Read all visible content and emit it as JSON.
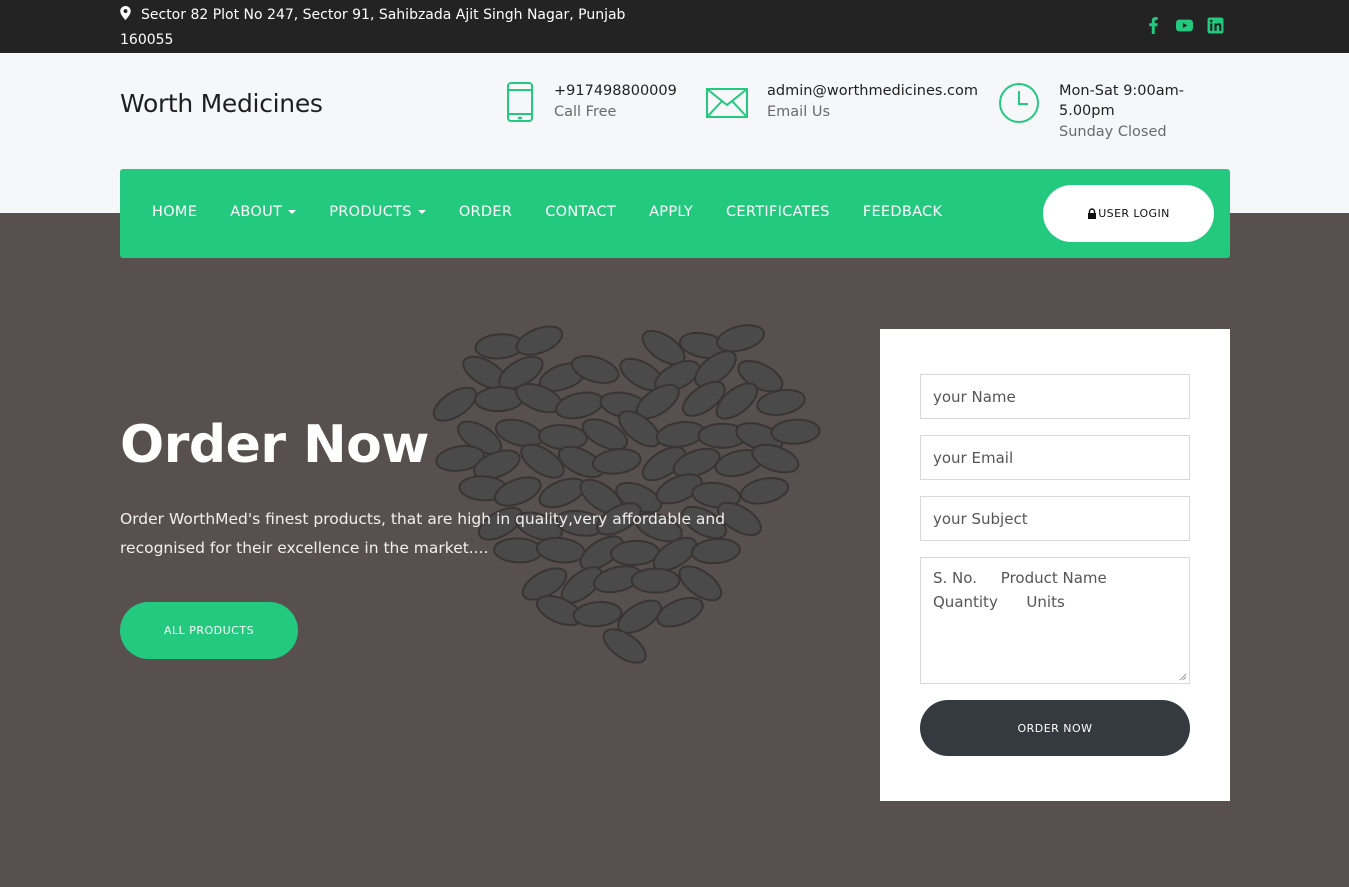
{
  "topbar": {
    "address": "Sector 82 Plot No 247, Sector 91, Sahibzada Ajit Singh Nagar, Punjab 160055",
    "social": [
      "facebook-icon",
      "youtube-icon",
      "linkedin-icon"
    ]
  },
  "header": {
    "brand": "Worth Medicines",
    "phone": {
      "value": "+917498800009",
      "label": "Call Free"
    },
    "email": {
      "value": "admin@worthmedicines.com",
      "label": "Email Us"
    },
    "hours": {
      "value": "Mon-Sat 9:00am-5.00pm",
      "label": "Sunday Closed"
    }
  },
  "nav": {
    "items": [
      {
        "label": "HOME",
        "dropdown": false
      },
      {
        "label": "ABOUT",
        "dropdown": true
      },
      {
        "label": "PRODUCTS",
        "dropdown": true
      },
      {
        "label": "ORDER",
        "dropdown": false
      },
      {
        "label": "CONTACT",
        "dropdown": false
      },
      {
        "label": "APPLY",
        "dropdown": false
      },
      {
        "label": "CERTIFICATES",
        "dropdown": false
      },
      {
        "label": "FEEDBACK",
        "dropdown": false
      }
    ],
    "login_label": "USER LOGIN"
  },
  "hero": {
    "title": "Order Now",
    "lead": "Order WorthMed's finest products, that are high in quality,very affordable and recognised for their excellence in the market....",
    "button": "ALL PRODUCTS"
  },
  "form": {
    "name_placeholder": "your Name",
    "email_placeholder": "your Email",
    "subject_placeholder": "your Subject",
    "message_placeholder": "S. No.     Product Name\nQuantity      Units",
    "submit": "ORDER NOW"
  },
  "colors": {
    "accent": "#22c97e",
    "dark": "#232323",
    "button_dark": "#343a40"
  }
}
